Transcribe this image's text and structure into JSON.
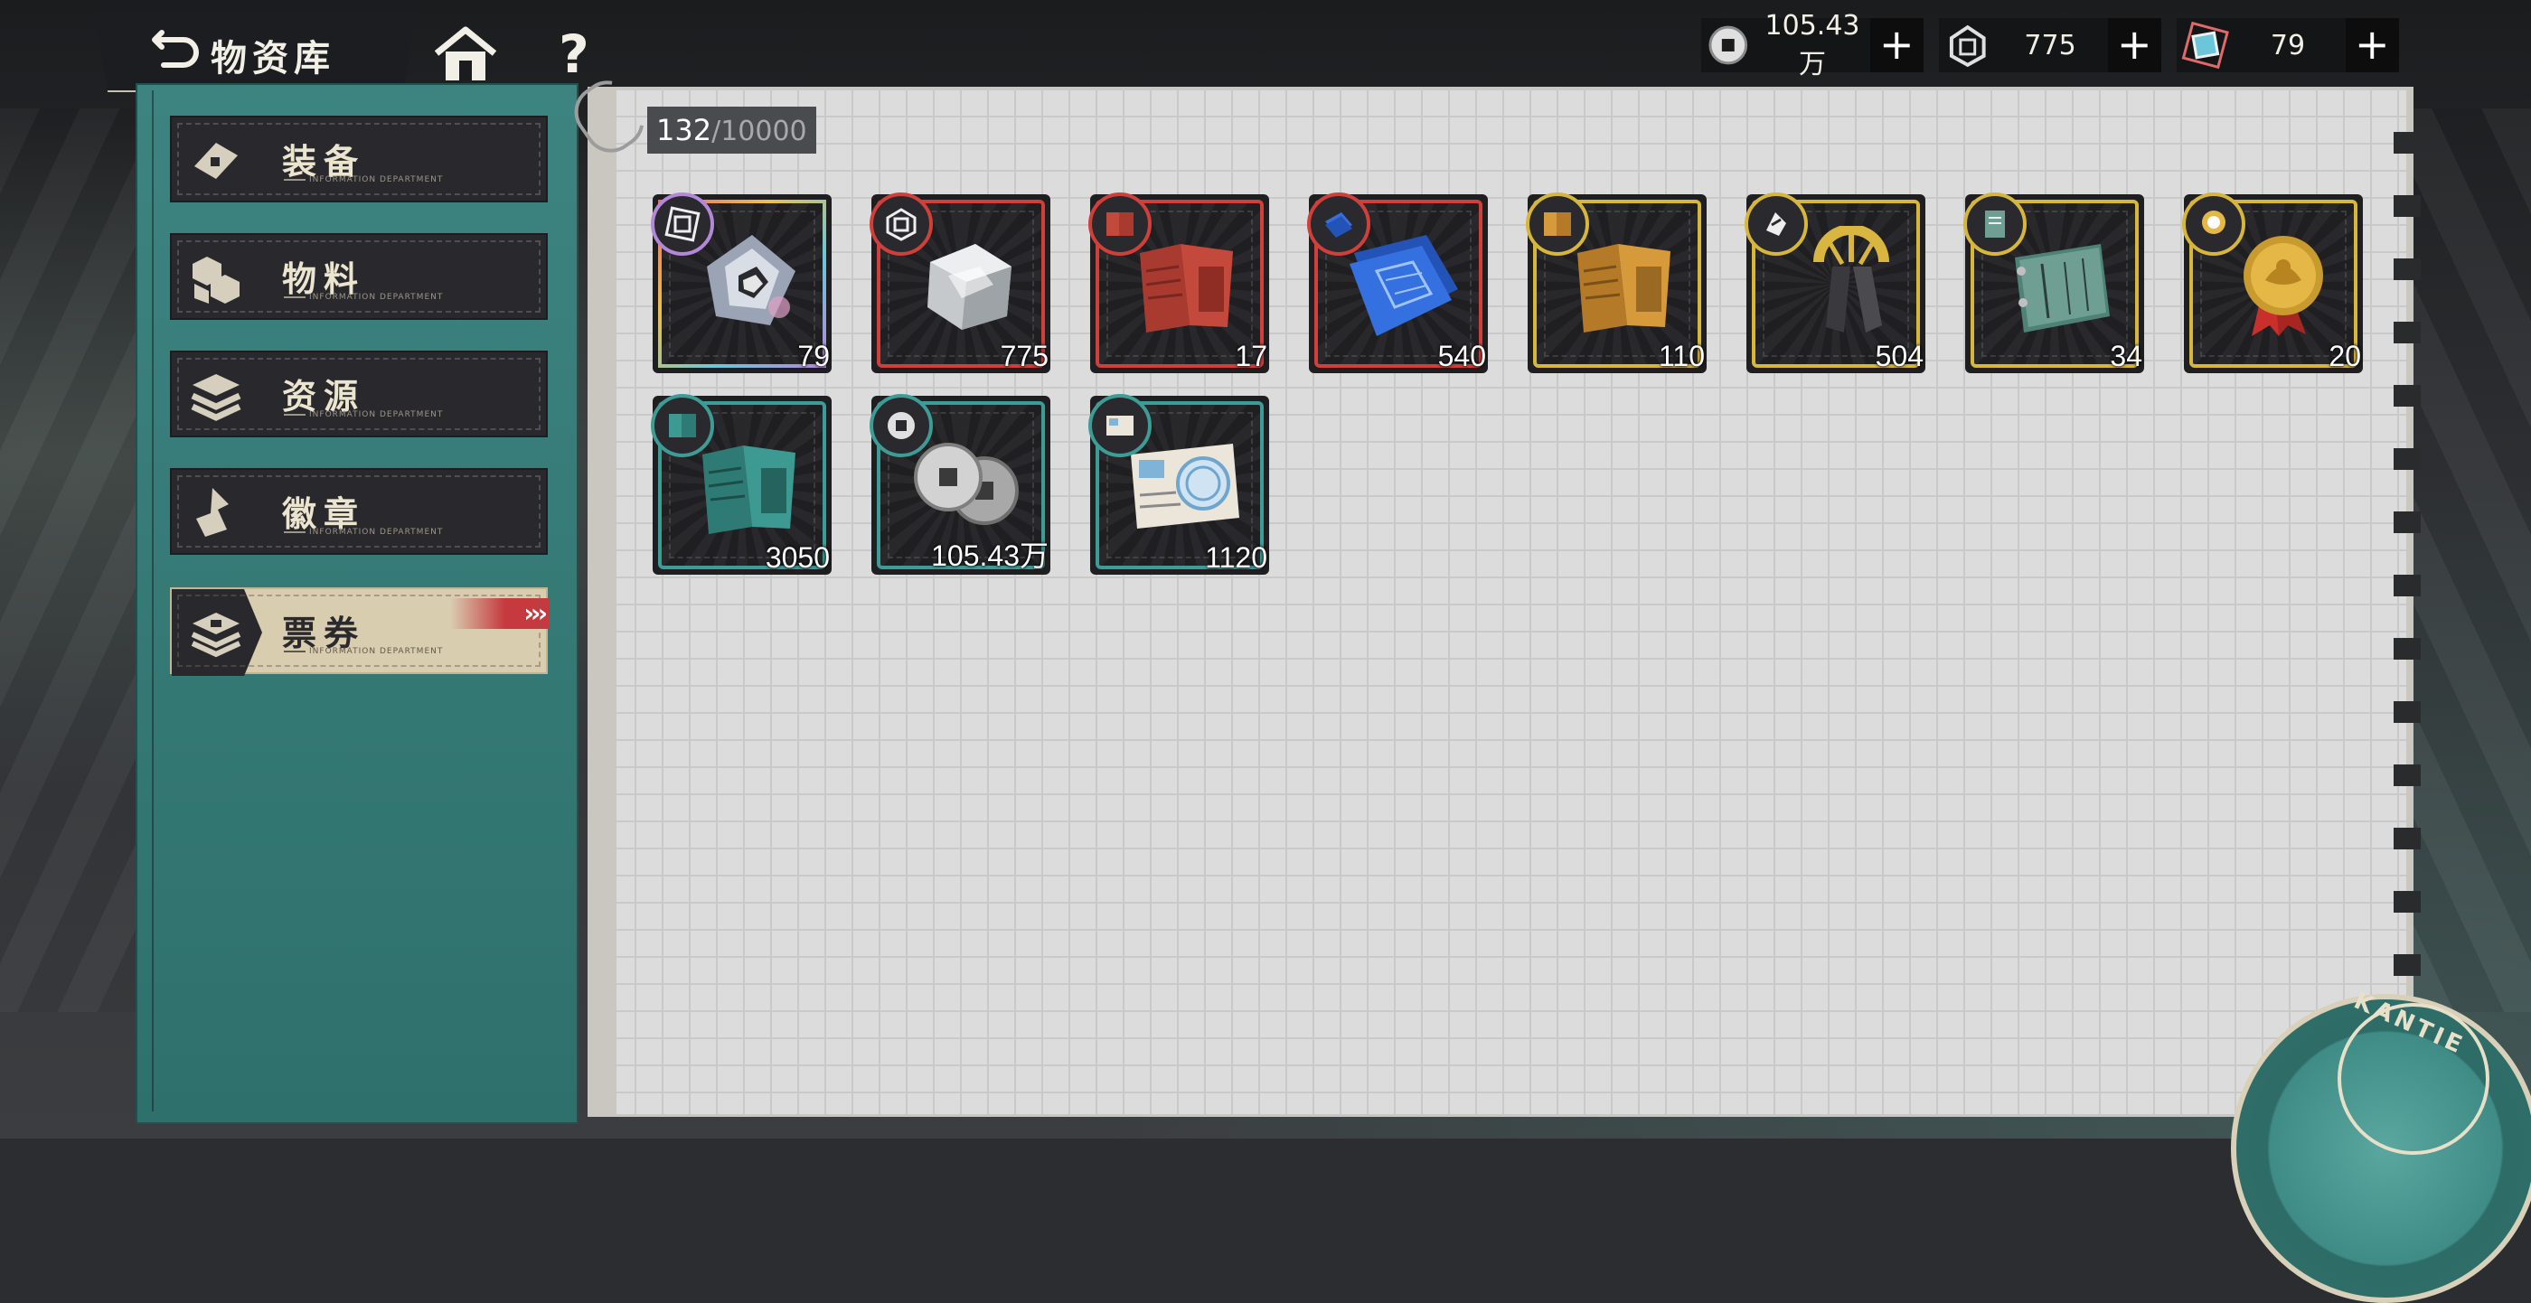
{
  "header": {
    "title": "物资库",
    "home_label": "home",
    "help_label": "?"
  },
  "currencies": [
    {
      "name": "coin",
      "value": "105.43万",
      "plus": "+"
    },
    {
      "name": "cube",
      "value": "775",
      "plus": "+"
    },
    {
      "name": "crystal",
      "value": "79",
      "plus": "+"
    }
  ],
  "sidebar": {
    "items": [
      {
        "label": "装备",
        "sub": "INFORMATION DEPARTMENT",
        "icon": "equipment-icon"
      },
      {
        "label": "物料",
        "sub": "INFORMATION DEPARTMENT",
        "icon": "materials-icon"
      },
      {
        "label": "资源",
        "sub": "INFORMATION DEPARTMENT",
        "icon": "resources-icon"
      },
      {
        "label": "徽章",
        "sub": "INFORMATION DEPARTMENT",
        "icon": "badge-icon"
      },
      {
        "label": "票券",
        "sub": "INFORMATION DEPARTMENT",
        "icon": "ticket-icon",
        "active": true,
        "arrows": "›››"
      }
    ]
  },
  "inventory": {
    "capacity_current": "132",
    "capacity_sep": "/",
    "capacity_max": "10000",
    "items": [
      {
        "name": "prism-crystal",
        "count": "79",
        "rarity": "rainbow"
      },
      {
        "name": "clear-cube",
        "count": "775",
        "rarity": "red"
      },
      {
        "name": "classified-file",
        "count": "17",
        "rarity": "red"
      },
      {
        "name": "blueprint",
        "count": "540",
        "rarity": "red"
      },
      {
        "name": "advance-manual",
        "count": "110",
        "rarity": "gold"
      },
      {
        "name": "gear-tool",
        "count": "504",
        "rarity": "gold"
      },
      {
        "name": "intel-notebook",
        "count": "34",
        "rarity": "gold"
      },
      {
        "name": "gold-medal",
        "count": "20",
        "rarity": "gold"
      },
      {
        "name": "brief-manual",
        "count": "3050",
        "rarity": "teal"
      },
      {
        "name": "silver-coins",
        "count": "105.43万",
        "rarity": "teal"
      },
      {
        "name": "letter-envelope",
        "count": "1120",
        "rarity": "teal"
      }
    ]
  },
  "decor": {
    "seal_text": "KANTIE"
  },
  "colors": {
    "teal_panel": "#3d8480",
    "red_rarity": "#d13f3b",
    "gold_rarity": "#d7b63c",
    "teal_rarity": "#3d9d96",
    "active_tab": "#d9cdb0",
    "accent_red": "#c63a3f"
  }
}
